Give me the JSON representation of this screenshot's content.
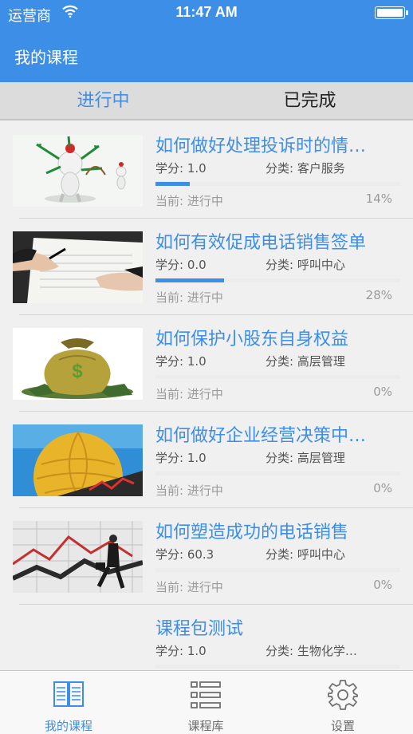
{
  "status_bar": {
    "carrier": "运营商",
    "time": "11:47 AM"
  },
  "nav": {
    "title": "我的课程"
  },
  "segments": [
    {
      "label": "进行中",
      "active": true
    },
    {
      "label": "已完成",
      "active": false
    }
  ],
  "courses": [
    {
      "title": "如何做好处理投诉时的情…",
      "credit": "学分: 1.0",
      "category": "分类: 客户服务",
      "state": "当前: 进行中",
      "percent_label": "14%",
      "progress": 0.14,
      "thumb": "cartoon-figures-image"
    },
    {
      "title": "如何有效促成电话销售签单",
      "credit": "学分: 0.0",
      "category": "分类: 呼叫中心",
      "state": "当前: 进行中",
      "percent_label": "28%",
      "progress": 0.28,
      "thumb": "signing-contract-image"
    },
    {
      "title": "如何保护小股东自身权益",
      "credit": "学分: 1.0",
      "category": "分类: 高层管理",
      "state": "当前: 进行中",
      "percent_label": "0%",
      "progress": 0,
      "thumb": "money-bag-image"
    },
    {
      "title": "如何做好企业经营决策中…",
      "credit": "学分: 1.0",
      "category": "分类: 高层管理",
      "state": "当前: 进行中",
      "percent_label": "0%",
      "progress": 0,
      "thumb": "golden-globe-image"
    },
    {
      "title": "如何塑造成功的电话销售",
      "credit": "学分: 60.3",
      "category": "分类: 呼叫中心",
      "state": "当前: 进行中",
      "percent_label": "0%",
      "progress": 0,
      "thumb": "businessman-chart-image"
    },
    {
      "title": "课程包测试",
      "credit": "学分: 1.0",
      "category": "分类: 生物化学…",
      "state": "",
      "percent_label": "",
      "progress": 0,
      "thumb": ""
    }
  ],
  "tabs": [
    {
      "label": "我的课程",
      "icon": "book-icon",
      "active": true
    },
    {
      "label": "课程库",
      "icon": "list-icon",
      "active": false
    },
    {
      "label": "设置",
      "icon": "gear-icon",
      "active": false
    }
  ],
  "colors": {
    "accent": "#3d8ee6",
    "background": "#f0f0f0"
  }
}
